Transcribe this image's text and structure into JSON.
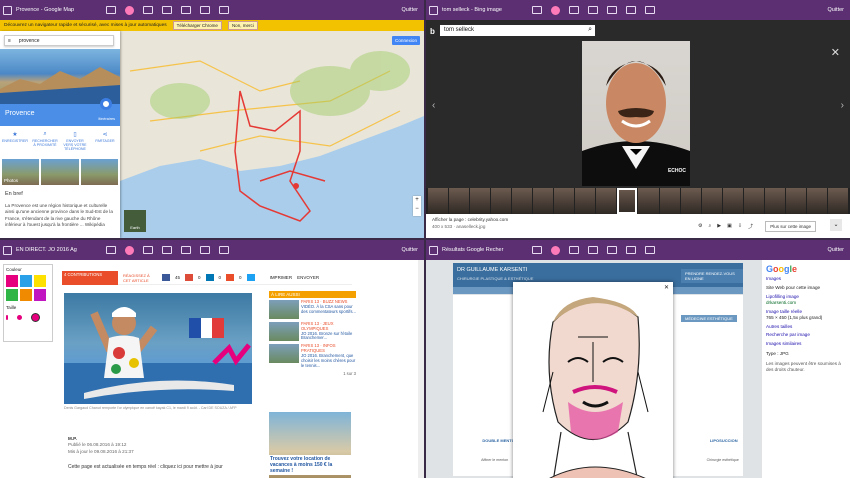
{
  "panes": {
    "top_left": {
      "window_title": "Provence - Google Map",
      "quit": "Quitter",
      "banner": {
        "text": "Découvrez un navigateur rapide et sécurisé, avec mises à jour automatiques",
        "download": "Télécharger Chrome",
        "no": "Non, merci"
      },
      "search_value": "provence",
      "connect_button": "Connexion",
      "place_name": "Provence",
      "itineraries": "Itinéraires",
      "actions": [
        {
          "label": "ENREGISTRER"
        },
        {
          "label": "RECHERCHER À PROXIMITÉ"
        },
        {
          "label": "ENVOYER VERS VOTRE TÉLÉPHONE"
        },
        {
          "label": "PARTAGER"
        }
      ],
      "photo_label": "Photos",
      "in_brief": "En bref",
      "description": "La Provence est une région historique et culturelle ainsi qu'une ancienne province dans le Sud-Est de la France, s'étendant de la rive gauche du Rhône inférieur à l'ouest jusqu'à la frontière ... Wikipédia",
      "earth_label": "Earth",
      "map_cities": [
        "Marseille",
        "Toulon",
        "Nice",
        "Avignon",
        "Monaco"
      ]
    },
    "top_right": {
      "window_title": "tom selleck - Bing image",
      "quit": "Quitter",
      "search_value": "tom selleck",
      "watermark": "ECHOC",
      "show_page": "Afficher la page : celebrity.yahoo.com",
      "dims": "400 x 533 · anaselleck.jpg",
      "more_button": "Plus sur cette image"
    },
    "bottom_left": {
      "window_title": "EN DIRECT. JO 2016 Ag",
      "quit": "Quitter",
      "palette_color": "Couleur",
      "palette_size": "Taille",
      "palette_colors": [
        "#e6007e",
        "#2aa0e8",
        "#ffe100",
        "#2fb545",
        "#f08a00",
        "#c015c0"
      ],
      "share": {
        "count": "4 CONTRIBUTIONS",
        "reactions": "RÉAGISSEZ À CET ARTICLE",
        "fb": "45",
        "g": "0",
        "in": "0",
        "gp": "0",
        "print": "IMPRIMER",
        "send": "ENVOYER"
      },
      "caption": "Denis Gargaud Chanut remporte l'or olympique en canoë kayak C1, le mardi 9 août. - Carl DE SOUZA / AFP",
      "author": "M.P.",
      "published": "Publié le 06.08.2016 à 19:12",
      "updated": "Mis à jour le 09.08.2016 à 21:37",
      "live_note": "Cette page est actualisée en temps réel : cliquez ici pour mettre à jour",
      "sidebar_header": "À LIRE AUSSI",
      "sidebar_items": [
        {
          "tag": "PARIS 13 · BUZZ NEWS",
          "text": "VIDÉO. À la CSA sans pour des commentateurs sportifs..."
        },
        {
          "tag": "PARIS 13 · JEUX OLYMPIQUES",
          "text": "JO 2016. Bronze sur l'étoile Branchemer..."
        },
        {
          "tag": "PARIS 13 · INFOS PRATIQUES",
          "text": "JO 2016. Branchement, que choisir les moins chères pour le tennis..."
        }
      ],
      "pager": "1 sur 3",
      "ad_text": "Trouvez votre location de vacances à moins 150 € la semaine !"
    },
    "bottom_right": {
      "window_title": "Résultats Google Recher",
      "quit": "Quitter",
      "site_name": "DR GUILLAUME KARSENTI",
      "site_sub": "CHIRURGIE PLASTIQUE & ESTHÉTIQUE",
      "site_btn": "PRENDRE RENDEZ-VOUS EN LIGNE",
      "site_btn2": "MÉDECINE ESTHÉTIQUE",
      "tabs": [
        "DOUBLE MENTON",
        "OTOPLASTIE",
        "LIFTING DU COU",
        "LIPOSUCCION"
      ],
      "captions": [
        "Affiner le menton",
        "Redresser les oreilles",
        "Lifting de la face et cou",
        "Chirurgie esthétique"
      ],
      "google": {
        "logo": "Google",
        "images": "Images",
        "site_label": "Site Web pour cette image",
        "site_title": "Lipofilling image",
        "site_url": "drkarsenti.com",
        "full_size": "Image taille réelle",
        "full_dims": "765 × 450 (1,5x plus grand)",
        "other_sizes": "Autres tailles",
        "similar": "Recherche par image",
        "similar2": "Images similaires",
        "type": "Type : JPG",
        "rights": "Les images peuvent être soumises à des droits d'auteur."
      }
    }
  }
}
